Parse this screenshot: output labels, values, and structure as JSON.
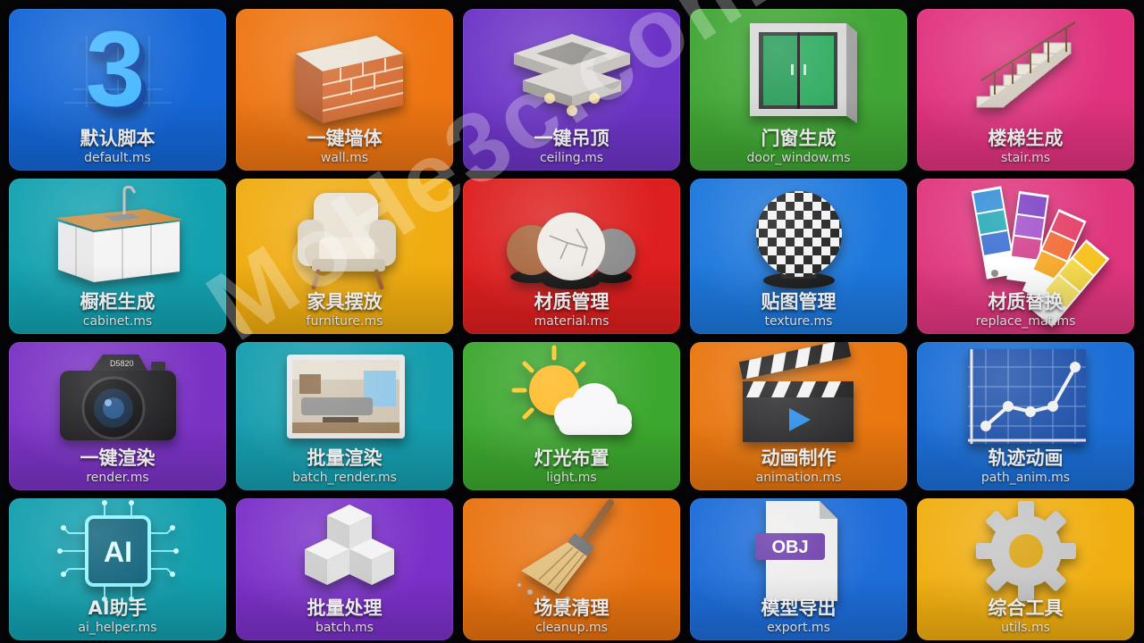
{
  "tiles": [
    {
      "title": "默认脚本",
      "file": "default.ms",
      "bg": "#1466d6",
      "icon": "number-3-icon"
    },
    {
      "title": "一键墙体",
      "file": "wall.ms",
      "bg": "#ee7512",
      "icon": "brick-wall-icon"
    },
    {
      "title": "一键吊顶",
      "file": "ceiling.ms",
      "bg": "#6c34c6",
      "icon": "ceiling-icon"
    },
    {
      "title": "门窗生成",
      "file": "door_window.ms",
      "bg": "#3fa533",
      "icon": "window-icon"
    },
    {
      "title": "楼梯生成",
      "file": "stair.ms",
      "bg": "#e0327e",
      "icon": "stair-icon"
    },
    {
      "title": "橱柜生成",
      "file": "cabinet.ms",
      "bg": "#13a1b0",
      "icon": "kitchen-cabinet-icon"
    },
    {
      "title": "家具摆放",
      "file": "furniture.ms",
      "bg": "#f0ac10",
      "icon": "armchair-icon"
    },
    {
      "title": "材质管理",
      "file": "material.ms",
      "bg": "#dd1e1e",
      "icon": "material-spheres-icon"
    },
    {
      "title": "贴图管理",
      "file": "texture.ms",
      "bg": "#1c77dc",
      "icon": "checker-sphere-icon"
    },
    {
      "title": "材质替换",
      "file": "replace_mat.ms",
      "bg": "#e0367e",
      "icon": "color-swatch-icon"
    },
    {
      "title": "一键渲染",
      "file": "render.ms",
      "bg": "#7a32c4",
      "icon": "camera-icon"
    },
    {
      "title": "批量渲染",
      "file": "batch_render.ms",
      "bg": "#159dae",
      "icon": "room-render-icon"
    },
    {
      "title": "灯光布置",
      "file": "light.ms",
      "bg": "#3ca72e",
      "icon": "sun-cloud-icon"
    },
    {
      "title": "动画制作",
      "file": "animation.ms",
      "bg": "#e9760f",
      "icon": "clapperboard-icon"
    },
    {
      "title": "轨迹动画",
      "file": "path_anim.ms",
      "bg": "#1b6ed6",
      "icon": "path-graph-icon"
    },
    {
      "title": "AI助手",
      "file": "ai_helper.ms",
      "bg": "#139fae",
      "icon": "ai-chip-icon"
    },
    {
      "title": "批量处理",
      "file": "batch.ms",
      "bg": "#7a30c8",
      "icon": "cubes-icon"
    },
    {
      "title": "场景清理",
      "file": "cleanup.ms",
      "bg": "#e8720f",
      "icon": "broom-icon"
    },
    {
      "title": "模型导出",
      "file": "export.ms",
      "bg": "#1d6cd8",
      "icon": "obj-file-icon",
      "badge": "OBJ"
    },
    {
      "title": "综合工具",
      "file": "utils.ms",
      "bg": "#f0ae10",
      "icon": "gear-icon"
    }
  ],
  "watermark": "MoHe3c.com"
}
